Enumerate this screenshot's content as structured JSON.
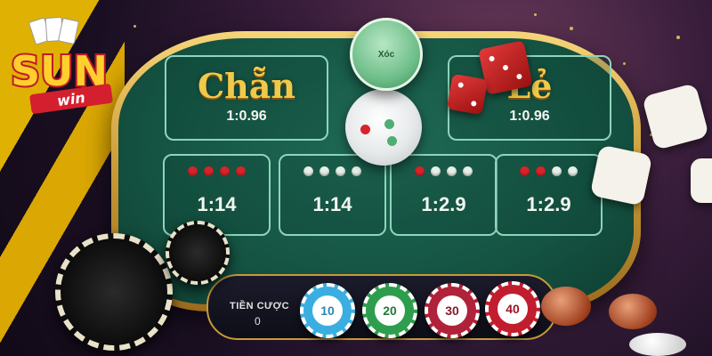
{
  "logo": {
    "text": "SUN",
    "subtext": "win"
  },
  "table": {
    "even": {
      "label": "Chẵn",
      "odds": "1:0.96"
    },
    "odd": {
      "label": "Lẻ",
      "odds": "1:0.96"
    },
    "lid_text": "Xóc",
    "cells": [
      {
        "odds": "1:14",
        "dots": [
          "red",
          "red",
          "red",
          "red"
        ]
      },
      {
        "odds": "1:14",
        "dots": [
          "white",
          "white",
          "white",
          "white"
        ]
      },
      {
        "odds": "1:2.9",
        "dots": [
          "red",
          "white",
          "white",
          "white"
        ]
      },
      {
        "odds": "1:2.9",
        "dots": [
          "red",
          "red",
          "white",
          "white"
        ]
      }
    ]
  },
  "bet": {
    "label": "TIỀN CƯỢC",
    "value": "0",
    "chips": [
      {
        "value": "10",
        "color": "#3aaee0"
      },
      {
        "value": "20",
        "color": "#2e9e4e"
      },
      {
        "value": "30",
        "color": "#b0223a"
      },
      {
        "value": "40",
        "color": "#c21d2e"
      }
    ]
  },
  "colors": {
    "felt": "#155443",
    "gold": "#f1c94a",
    "red_dot": "#d8232a"
  }
}
